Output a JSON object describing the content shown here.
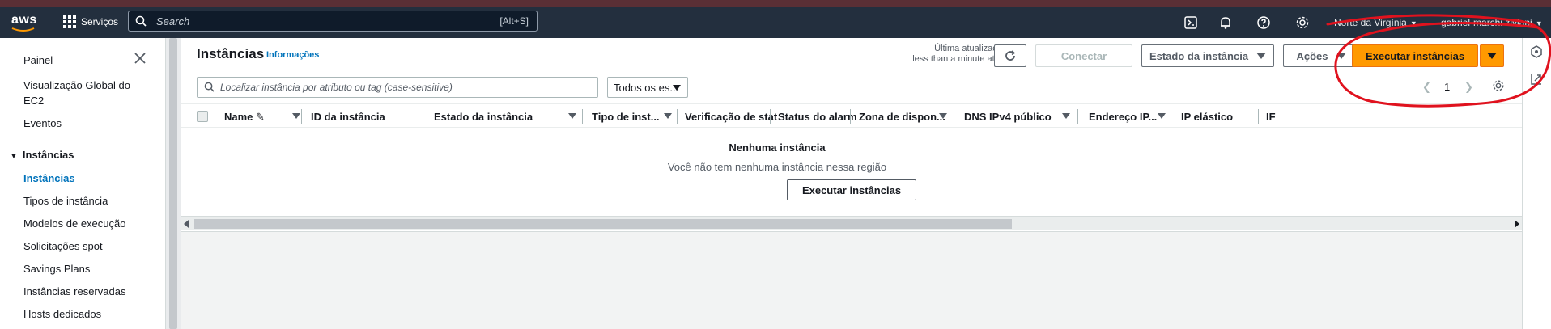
{
  "nav": {
    "logo_text": "aws",
    "services_label": "Serviços",
    "search_placeholder": "Search",
    "search_shortcut": "[Alt+S]",
    "region_label": "Norte da Virgínia",
    "user_label": "gabriel-marchi ziviani"
  },
  "sidebar": {
    "items": [
      {
        "label": "Painel"
      },
      {
        "label": "Visualização Global do EC2"
      },
      {
        "label": "Eventos"
      },
      {
        "label": "Instâncias"
      },
      {
        "label": "Instâncias"
      },
      {
        "label": "Tipos de instância"
      },
      {
        "label": "Modelos de execução"
      },
      {
        "label": "Solicitações spot"
      },
      {
        "label": "Savings Plans"
      },
      {
        "label": "Instâncias reservadas"
      },
      {
        "label": "Hosts dedicados"
      }
    ]
  },
  "panel": {
    "title": "Instâncias",
    "info_link": "Informações",
    "last_update_line1": "Última atualização",
    "last_update_line2": "less than a minute atrás",
    "connect_label": "Conectar",
    "instance_state_label": "Estado da instância",
    "actions_label": "Ações",
    "launch_label": "Executar instâncias",
    "filter_placeholder": "Localizar instância por atributo ou tag (case-sensitive)",
    "state_filter_value": "Todos os es...",
    "page_number": "1"
  },
  "table": {
    "columns": [
      "Name",
      "ID da instância",
      "Estado da instância",
      "Tipo de inst...",
      "Verificação de stat",
      "Status do alarm",
      "Zona de dispon...",
      "DNS IPv4 público",
      "Endereço IP...",
      "IP elástico",
      "IF"
    ],
    "empty_title": "Nenhuma instância",
    "empty_message": "Você não tem nenhuma instância nessa região",
    "empty_button": "Executar instâncias"
  },
  "colors": {
    "nav_bg": "#232f3e",
    "primary": "#ff9900",
    "link": "#0073bb",
    "annotation": "#e0121e"
  }
}
